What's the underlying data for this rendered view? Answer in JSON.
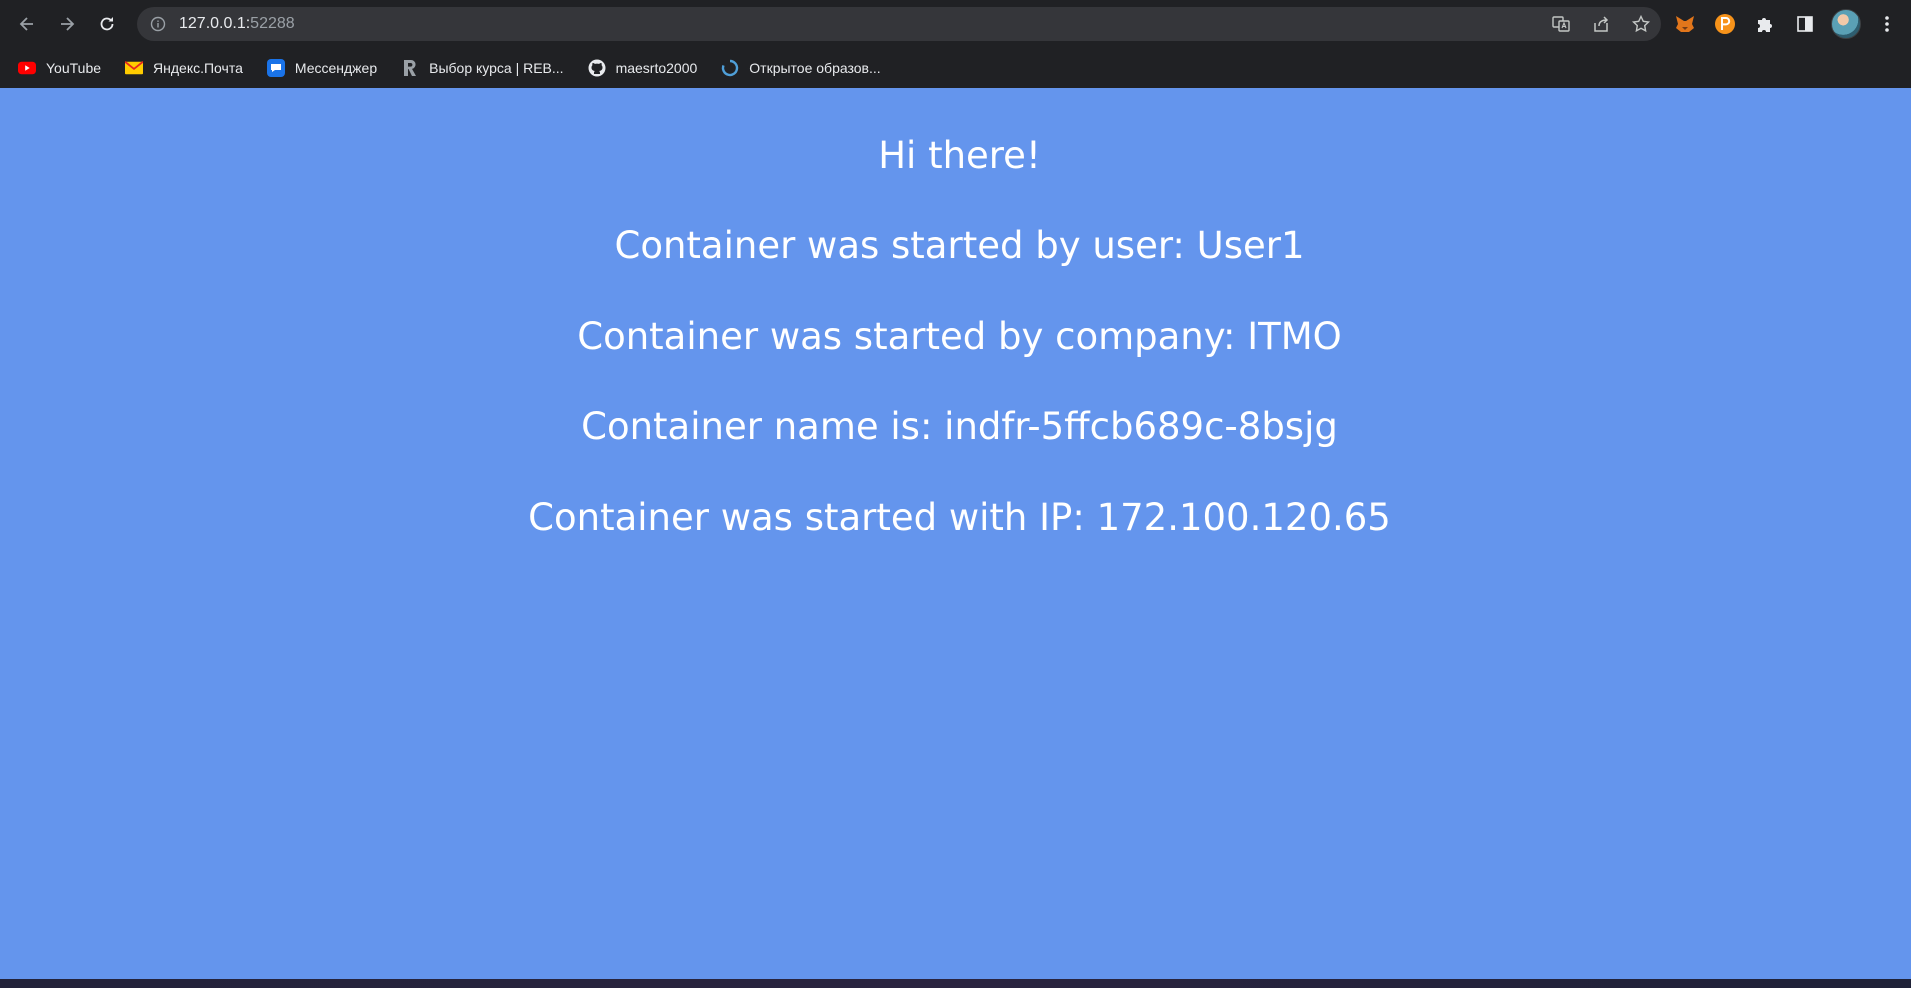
{
  "browser": {
    "url_host": "127.0.0.1:",
    "url_port": "52288",
    "bookmarks": [
      {
        "label": "YouTube",
        "icon": "youtube-icon"
      },
      {
        "label": "Яндекс.Почта",
        "icon": "mail-icon"
      },
      {
        "label": "Мессенджер",
        "icon": "messenger-icon"
      },
      {
        "label": "Выбор курса | REB...",
        "icon": "r-logo-icon"
      },
      {
        "label": "maesrto2000",
        "icon": "github-icon"
      },
      {
        "label": "Открытое образов...",
        "icon": "loading-icon"
      }
    ]
  },
  "page": {
    "background_color": "#6495ed",
    "lines": [
      "Hi there!",
      "Container was started by user: User1",
      "Container was started by company: ITMO",
      "Container name is: indfr-5ffcb689c-8bsjg",
      "Container was started with IP: 172.100.120.65"
    ]
  }
}
